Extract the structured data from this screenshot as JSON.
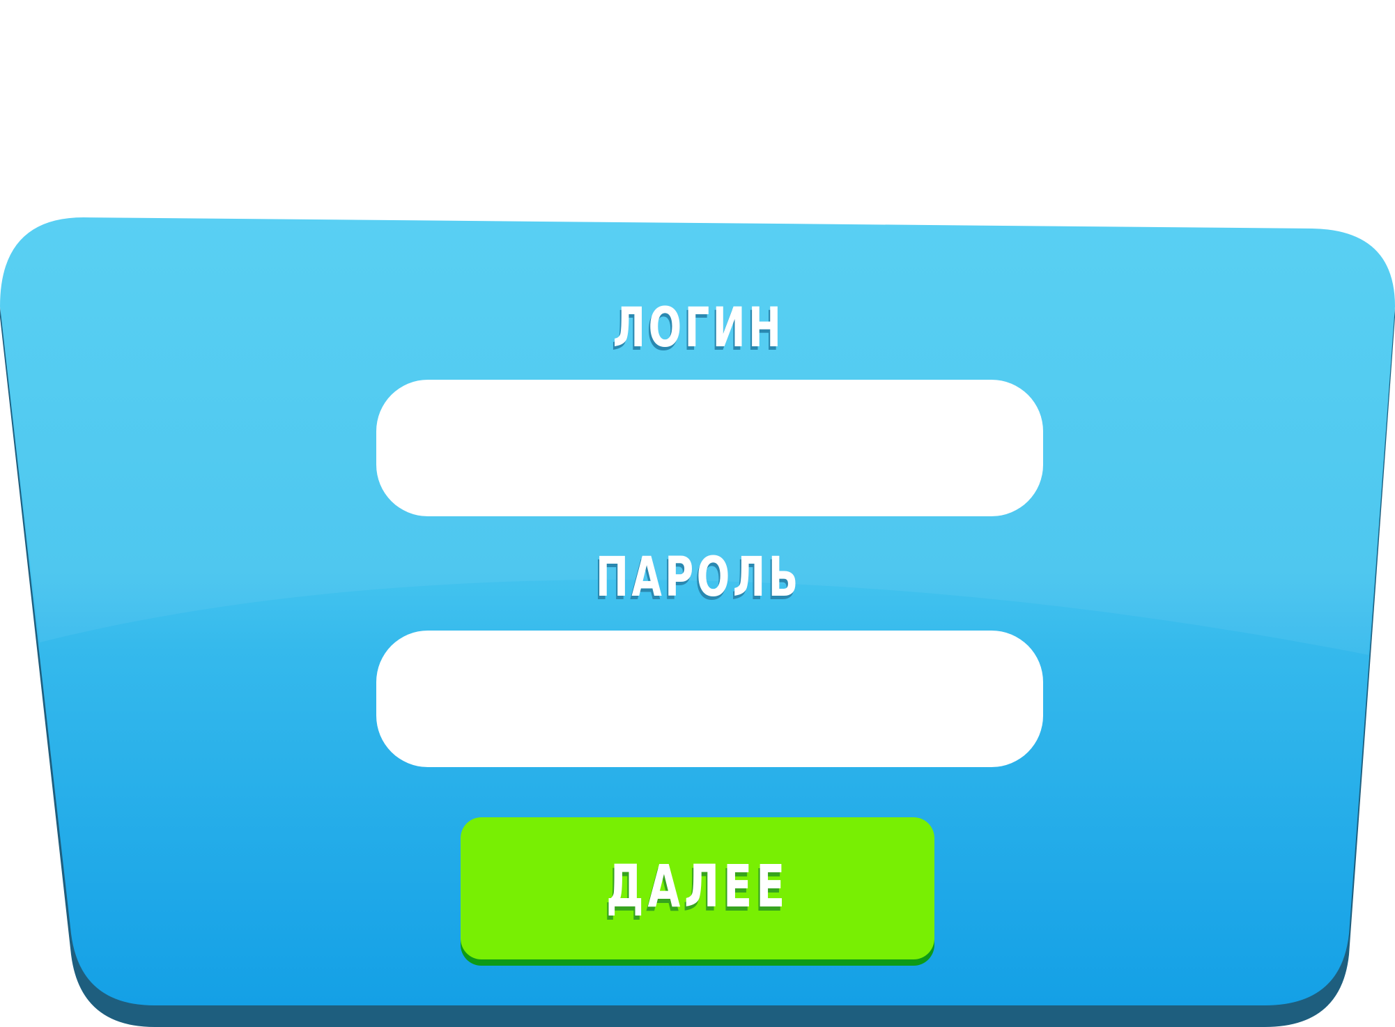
{
  "form": {
    "login_label": "ЛОГИН",
    "login_value": "",
    "password_label": "ПАРОЛЬ",
    "password_value": "",
    "submit_label": "ДАЛЕЕ"
  },
  "colors": {
    "panel_top": "#4fcdf3",
    "panel_bottom": "#14a0e6",
    "panel_shadow": "#1e5e7e",
    "field_background": "#ffffff",
    "button": "#78ef03",
    "button_shadow": "#0d9a17",
    "label_text": "#ffffff"
  }
}
